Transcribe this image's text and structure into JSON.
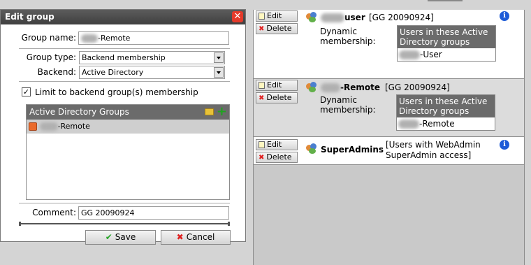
{
  "dialog": {
    "title": "Edit group",
    "close_icon": "close-icon",
    "group_name_label": "Group name:",
    "group_name_value": "-Remote",
    "group_type_label": "Group type:",
    "group_type_value": "Backend membership",
    "backend_label": "Backend:",
    "backend_value": "Active Directory",
    "limit_checked": true,
    "limit_check_glyph": "✓",
    "limit_label": "Limit to backend group(s) membership",
    "ad_groups_header": "Active Directory Groups",
    "ad_groups_items": [
      "-Remote"
    ],
    "comment_label": "Comment:",
    "comment_value": "GG 20090924",
    "save_label": "Save",
    "save_glyph": "✔",
    "cancel_label": "Cancel",
    "cancel_glyph": "✖"
  },
  "groups": [
    {
      "name_suffix": "user",
      "comment": "[GG 20090924]",
      "edit_label": "Edit",
      "delete_label": "Delete",
      "dynamic_label_1": "Dynamic",
      "dynamic_label_2": "membership:",
      "dynamic_header": "Users in these Active Directory groups",
      "dynamic_member": "-User"
    },
    {
      "name_suffix": "-Remote",
      "comment": "[GG 20090924]",
      "edit_label": "Edit",
      "delete_label": "Delete",
      "dynamic_label_1": "Dynamic",
      "dynamic_label_2": "membership:",
      "dynamic_header": "Users in these Active Directory groups",
      "dynamic_member": "-Remote"
    },
    {
      "name": "SuperAdmins",
      "comment_line1": "[Users with WebAdmin",
      "comment_line2": "SuperAdmin access]",
      "edit_label": "Edit",
      "delete_label": "Delete"
    }
  ],
  "icons": {
    "info": "i",
    "delete_glyph": "✖",
    "plus": "+"
  }
}
